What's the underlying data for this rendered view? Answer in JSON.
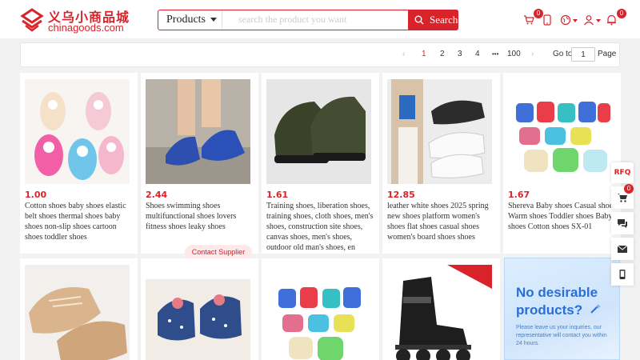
{
  "logo": {
    "cn_text": "义乌小商品城",
    "en_text": "chinagoods.com"
  },
  "search": {
    "category": "Products",
    "placeholder": "search the product you want",
    "button_label": "Search"
  },
  "header_icons": {
    "cart_count": "0",
    "notification_count": "0"
  },
  "pagination": {
    "pages": [
      "1",
      "2",
      "3",
      "4",
      "•••",
      "100"
    ],
    "current": "1",
    "goto_label": "Go to",
    "goto_value": "1",
    "page_label": "Page"
  },
  "products": [
    {
      "price": "1.00",
      "title": "Cotton shoes baby shoes elastic belt shoes thermal shoes baby shoes non-slip shoes cartoon shoes toddler shoes"
    },
    {
      "price": "2.44",
      "title": "Shoes swimming shoes multifunctional shoes lovers fitness shoes leaky shoes"
    },
    {
      "price": "1.61",
      "title": "Training shoes, liberation shoes, training shoes, cloth shoes, men's shoes, construction site shoes, canvas shoes, men's shoes, outdoor old man's shoes, en"
    },
    {
      "price": "12.85",
      "title": "leather white shoes 2025 spring new shoes platform women's shoes flat shoes casual shoes women's board shoes shoes"
    },
    {
      "price": "1.67",
      "title": "Shereva Baby shoes Casual shoes Warm shoes Toddler shoes Baby shoes Cotton shoes SX-01"
    }
  ],
  "contact_supplier": "Contact Supplier",
  "promo": {
    "title": "No desirable products?",
    "subtitle": "Please leave us your inquiries, our representative will contact you within 24 hours."
  },
  "float_bar": {
    "rfq_label": "RFQ",
    "cart_count": "0"
  },
  "colors": {
    "brand": "#d8232a",
    "promo_blue": "#2a6fd6"
  }
}
